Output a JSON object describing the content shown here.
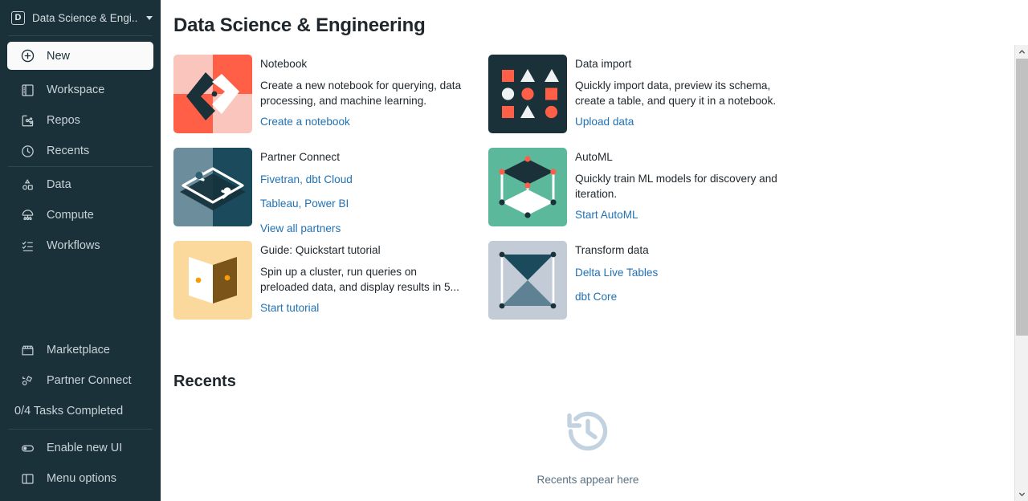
{
  "sidebar": {
    "header": {
      "logo_glyph": "D",
      "title": "Data Science & Engi...",
      "caret": "chevron-down-icon"
    },
    "new_button": {
      "label": "New",
      "icon": "plus-circle-icon"
    },
    "group_primary": [
      {
        "label": "Workspace",
        "icon": "workspace-icon"
      },
      {
        "label": "Repos",
        "icon": "repos-icon"
      },
      {
        "label": "Recents",
        "icon": "clock-icon"
      }
    ],
    "group_secondary": [
      {
        "label": "Data",
        "icon": "data-shapes-icon"
      },
      {
        "label": "Compute",
        "icon": "compute-icon"
      },
      {
        "label": "Workflows",
        "icon": "workflows-checklist-icon"
      }
    ],
    "group_bottom": [
      {
        "label": "Marketplace",
        "icon": "marketplace-store-icon"
      },
      {
        "label": "Partner Connect",
        "icon": "partner-connect-icon"
      }
    ],
    "tasks_label": "0/4 Tasks Completed",
    "group_footer": [
      {
        "label": "Enable new UI",
        "icon": "toggle-icon"
      },
      {
        "label": "Menu options",
        "icon": "panel-layout-icon"
      }
    ]
  },
  "main": {
    "page_title": "Data Science & Engineering",
    "cards": [
      {
        "id": "notebook",
        "title": "Notebook",
        "description": "Create a new notebook for querying, data processing, and machine learning.",
        "links": [
          "Create a notebook"
        ],
        "thumb_icon": "notebook-chevrons-icon"
      },
      {
        "id": "data-import",
        "title": "Data import",
        "description": "Quickly import data, preview its schema, create a table, and query it in a notebook.",
        "links": [
          "Upload data"
        ],
        "thumb_icon": "data-import-shapes-grid-icon"
      },
      {
        "id": "partner-connect",
        "title": "Partner Connect",
        "description": "",
        "links": [
          "Fivetran, dbt Cloud",
          "Tableau, Power BI",
          "View all partners"
        ],
        "thumb_icon": "partner-connect-diamond-loop-icon"
      },
      {
        "id": "automl",
        "title": "AutoML",
        "description": "Quickly train ML models for discovery and iteration.",
        "links": [
          "Start AutoML"
        ],
        "thumb_icon": "automl-cube-icon"
      },
      {
        "id": "quickstart-guide",
        "title": "Guide: Quickstart tutorial",
        "description": "Spin up a cluster, run queries on preloaded data, and display results in 5...",
        "links": [
          "Start tutorial"
        ],
        "thumb_icon": "guide-open-book-icon"
      },
      {
        "id": "transform-data",
        "title": "Transform data",
        "description": "",
        "links": [
          "Delta Live Tables",
          "dbt Core"
        ],
        "thumb_icon": "transform-hourglass-icon"
      }
    ],
    "recents": {
      "heading": "Recents",
      "empty_label": "Recents appear here",
      "empty_icon": "history-clock-icon"
    }
  },
  "colors": {
    "sidebar_bg": "#1b3139",
    "link_blue": "#2272b4",
    "text_dark": "#1f272d",
    "coral": "#ff5f46",
    "coral_light": "#f9c5bd",
    "navy": "#1b3139",
    "green": "#5cb89a",
    "slate": "#5e8294",
    "sand": "#fbd89b",
    "brown": "#7a5418",
    "amber": "#f59e0b",
    "gray_blue": "#c3ccd6"
  },
  "scrollbar": {
    "up_icon": "chevron-up-icon",
    "down_icon": "chevron-down-icon"
  }
}
